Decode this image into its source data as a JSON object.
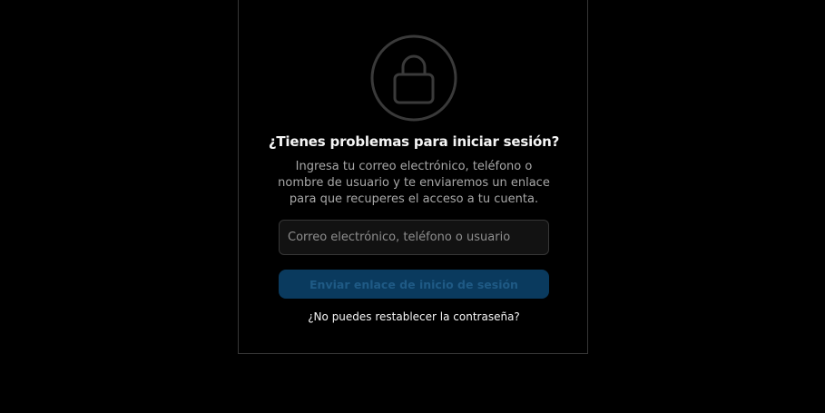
{
  "recovery": {
    "title": "¿Tienes problemas para iniciar sesión?",
    "description": "Ingresa tu correo electrónico, teléfono o nombre de usuario y te enviaremos un enlace para que recuperes el acceso a tu cuenta.",
    "input_placeholder": "Correo electrónico, teléfono o usuario",
    "input_value": "",
    "send_button_label": "Enviar enlace de inicio de sesión",
    "reset_link_label": "¿No puedes restablecer la contraseña?"
  },
  "icons": {
    "lock": "lock-icon"
  },
  "colors": {
    "background": "#000000",
    "card_border": "#363636",
    "text_primary": "#f5f5f5",
    "text_secondary": "#a8a8a8",
    "button_disabled_bg": "#0a3a5e",
    "button_disabled_text": "#1f5a85"
  }
}
